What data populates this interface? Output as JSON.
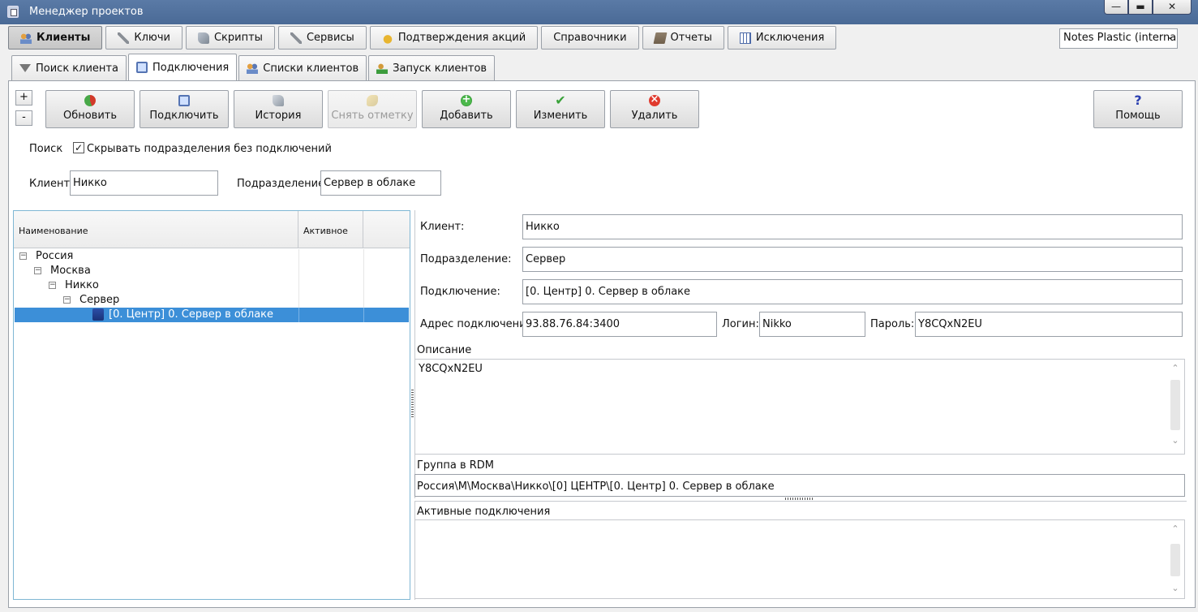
{
  "window": {
    "title": "Менеджер проектов",
    "minimize": "—",
    "maximize": "▬",
    "close": "✕"
  },
  "main_tabs": [
    {
      "label": "Клиенты",
      "icon": "users-icon"
    },
    {
      "label": "Ключи",
      "icon": "wrench-icon"
    },
    {
      "label": "Скрипты",
      "icon": "script-icon"
    },
    {
      "label": "Сервисы",
      "icon": "wrench-icon"
    },
    {
      "label": "Подтверждения акций",
      "icon": "hand-icon"
    },
    {
      "label": "Справочники",
      "icon": ""
    },
    {
      "label": "Отчеты",
      "icon": "book-icon"
    },
    {
      "label": "Исключения",
      "icon": "grid-icon"
    }
  ],
  "client_select": {
    "value": "Notes Plastic (interna",
    "dropdown": "⌄"
  },
  "sub_tabs": [
    {
      "label": "Поиск клиента"
    },
    {
      "label": "Подключения"
    },
    {
      "label": "Списки клиентов"
    },
    {
      "label": "Запуск клиентов"
    }
  ],
  "toolbar": {
    "plus": "+",
    "minus": "-",
    "refresh": "Обновить",
    "connect": "Подключить",
    "history": "История",
    "clear_mark": "Снять отметку",
    "add": "Добавить",
    "edit": "Изменить",
    "delete": "Удалить",
    "help": "Помощь"
  },
  "search": {
    "label": "Поиск",
    "hide_checkbox_label": "Скрывать подразделения без подключений",
    "hide_checked": "✓",
    "client_label": "Клиент:",
    "client_value": "Никко",
    "division_label": "Подразделение:",
    "division_value": "Сервер в облаке"
  },
  "grid": {
    "columns": [
      "Наименование",
      "Активное"
    ],
    "rows": [
      {
        "level": 0,
        "text": "Россия",
        "expander": "−"
      },
      {
        "level": 1,
        "text": "Москва",
        "expander": "−"
      },
      {
        "level": 2,
        "text": "Никко",
        "expander": "−"
      },
      {
        "level": 3,
        "text": "Сервер",
        "expander": "−"
      },
      {
        "level": 4,
        "text": "[0. Центр] 0. Сервер в облаке",
        "selected": true
      }
    ]
  },
  "details": {
    "client_label": "Клиент:",
    "client_value": "Никко",
    "division_label": "Подразделение:",
    "division_value": "Сервер",
    "connection_label": "Подключение:",
    "connection_value": "[0. Центр] 0. Сервер в облаке",
    "address_label": "Адрес подключения",
    "address_value": "93.88.76.84:3400",
    "login_label": "Логин:",
    "login_value": "Nikko",
    "password_label": "Пароль:",
    "password_value": "Y8CQxN2EU",
    "description_label": "Описание",
    "description_value": "Y8CQxN2EU",
    "rdm_label": "Группа в RDM",
    "rdm_value": "Россия\\М\\Москва\\Никко\\[0] ЦЕНТР\\[0. Центр] 0. Сервер в облаке",
    "active_label": "Активные подключения",
    "scroll_up": "⌃",
    "scroll_down": "⌄"
  }
}
